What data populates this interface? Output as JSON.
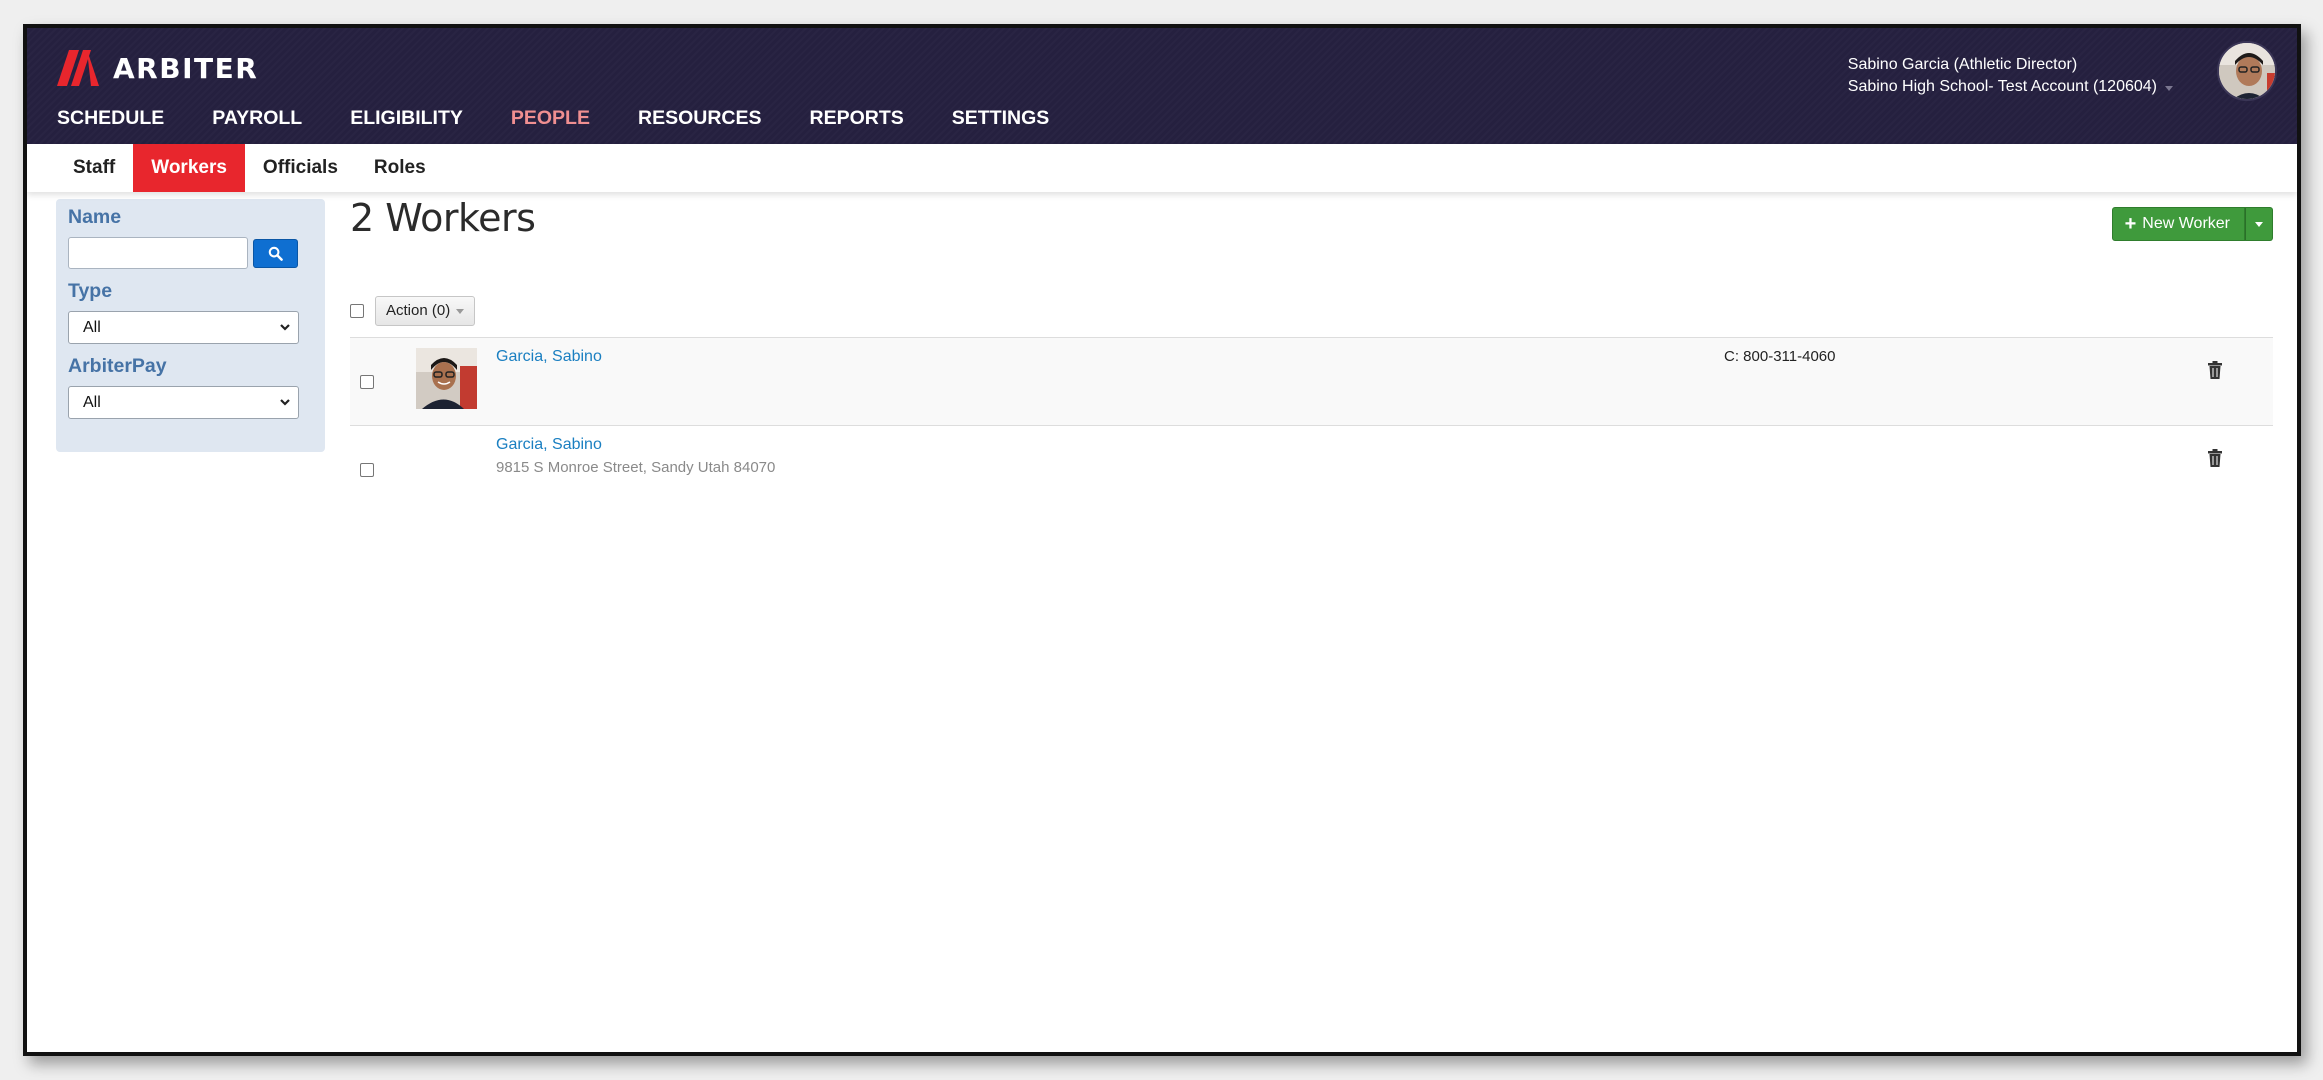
{
  "header": {
    "brand": "ARBITER",
    "nav": [
      {
        "label": "SCHEDULE"
      },
      {
        "label": "PAYROLL"
      },
      {
        "label": "ELIGIBILITY"
      },
      {
        "label": "PEOPLE"
      },
      {
        "label": "RESOURCES"
      },
      {
        "label": "REPORTS"
      },
      {
        "label": "SETTINGS"
      }
    ],
    "active_nav": "PEOPLE",
    "user_name": "Sabino Garcia (Athletic Director)",
    "school": "Sabino High School- Test Account (120604)"
  },
  "subnav": {
    "tabs": [
      {
        "label": "Staff"
      },
      {
        "label": "Workers"
      },
      {
        "label": "Officials"
      },
      {
        "label": "Roles"
      }
    ],
    "active_tab": "Workers"
  },
  "filters": {
    "name_label": "Name",
    "name_value": "",
    "type_label": "Type",
    "type_value": "All",
    "arbiterpay_label": "ArbiterPay",
    "arbiterpay_value": "All"
  },
  "main": {
    "title": "2 Workers",
    "new_worker_label": "New Worker",
    "action_label": "Action (0)",
    "workers": [
      {
        "name": "Garcia, Sabino",
        "address": "",
        "phone": "C: 800-311-4060",
        "has_photo": true
      },
      {
        "name": "Garcia, Sabino",
        "address": "9815 S Monroe Street, Sandy Utah 84070",
        "phone": "",
        "has_photo": false
      }
    ]
  },
  "colors": {
    "header_bg": "#25203f",
    "active_nav": "#f08f91",
    "active_tab": "#e8262d",
    "link": "#1a7fc1",
    "filter_label": "#4673a6",
    "new_button": "#3f9a3c",
    "search_button": "#0f6fd1"
  },
  "icons": {
    "logo": "arbiter-logo-icon",
    "search": "search-icon",
    "plus": "plus-icon",
    "trash": "trash-icon",
    "caret": "chevron-down-icon"
  }
}
